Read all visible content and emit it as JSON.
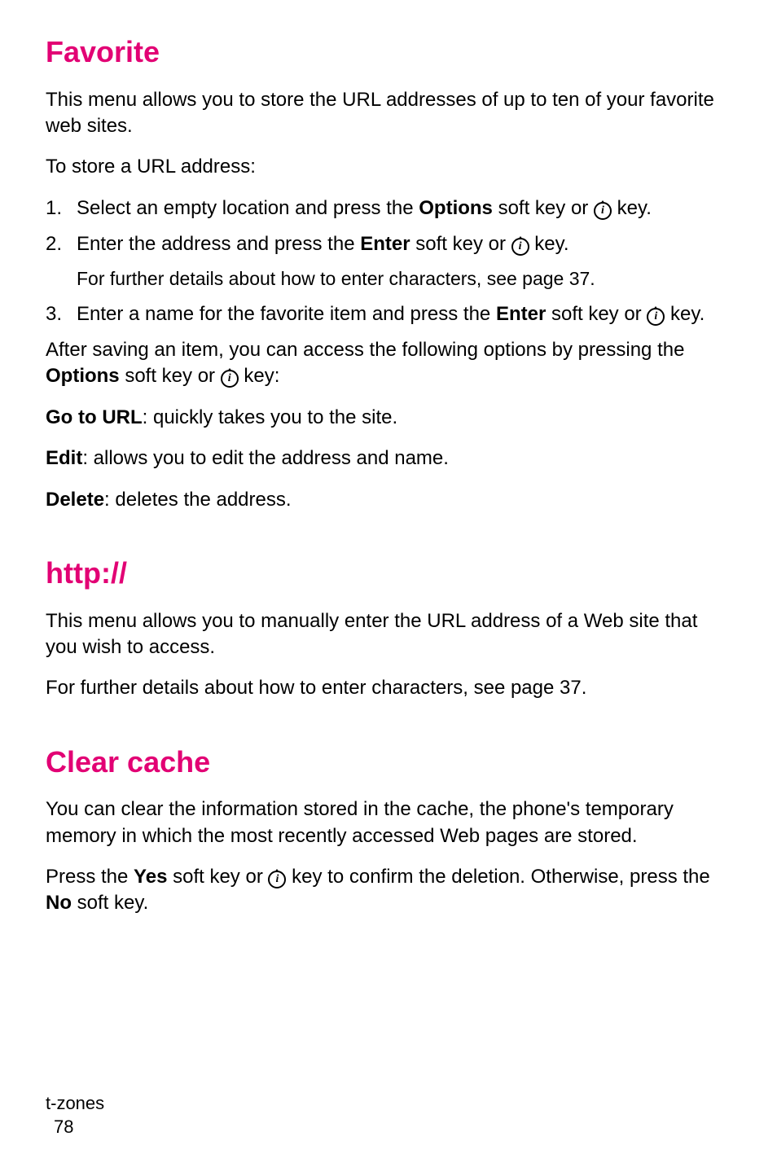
{
  "sections": {
    "favorite": {
      "heading": "Favorite",
      "intro": "This menu allows you to store the URL addresses of up to ten of your favorite web sites.",
      "lead": "To store a URL address:",
      "steps": [
        {
          "num": "1.",
          "pre": "Select an empty location and press the ",
          "bold1": "Options",
          "mid": " soft key or ",
          "post": " key."
        },
        {
          "num": "2.",
          "pre": "Enter the address and press the ",
          "bold1": "Enter",
          "mid": " soft key or ",
          "post": " key.",
          "sub": "For further details about how to enter characters, see page 37."
        },
        {
          "num": "3.",
          "pre": "Enter a name for the favorite item and press the ",
          "bold1": "Enter",
          "mid": " soft key or ",
          "post": " key."
        }
      ],
      "afterSave": {
        "pre": "After saving an item, you can access the following options by pressing the ",
        "bold": "Options",
        "mid": " soft key or ",
        "post": " key:"
      },
      "opts": [
        {
          "label": "Go to URL",
          "desc": ": quickly takes you to the site."
        },
        {
          "label": "Edit",
          "desc": ": allows you to edit the address and name."
        },
        {
          "label": "Delete",
          "desc": ": deletes the address."
        }
      ]
    },
    "http": {
      "heading": "http://",
      "p1": "This menu allows you to manually enter the URL address of a Web site that you wish to access.",
      "p2": "For further details about how to enter characters, see page 37."
    },
    "clear": {
      "heading": "Clear cache",
      "p1": "You can clear the information stored in the cache, the phone's temporary memory in which the most recently accessed Web pages are stored.",
      "p2": {
        "pre1": "Press the ",
        "yes": "Yes",
        "mid1": " soft key or ",
        "post1": " key to confirm the deletion. Otherwise, press the ",
        "no": "No",
        "post2": " soft key."
      }
    }
  },
  "footer": {
    "title": "t-zones",
    "page": "78"
  },
  "icon_glyph": "i"
}
